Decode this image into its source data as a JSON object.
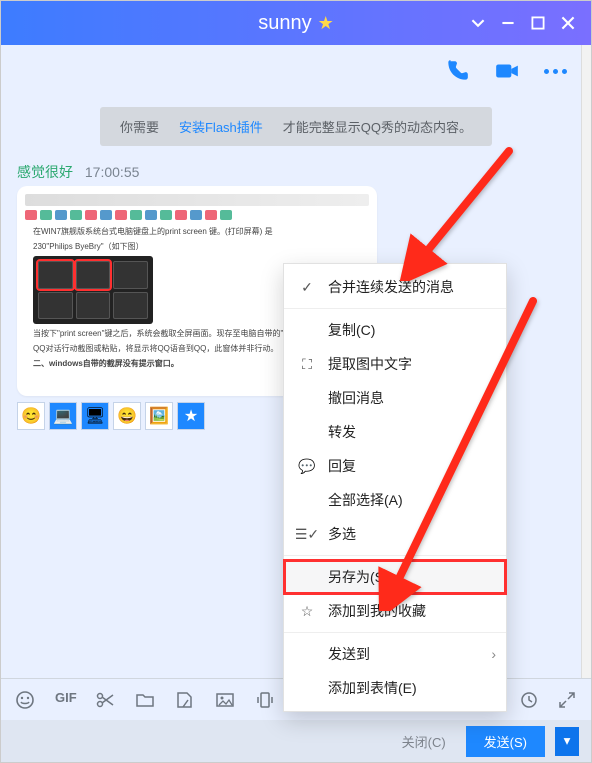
{
  "title": "sunny",
  "notice": {
    "prefix": "你需要",
    "link": "安装Flash插件",
    "suffix": "才能完整显示QQ秀的动态内容。"
  },
  "message": {
    "sender": "感觉很好",
    "time": "17:00:55",
    "inner_lines": {
      "l1": "在WIN7旗舰版系统台式电脑键盘上的print screen 键。(打印屏幕) 是",
      "l2": "230\"Philips ByeBry\"（如下图）",
      "l3": "当按下\"print screen\"键之后，系统会截取全屏画面。现存至电脑自带的\"剪贴板\"中。即使在",
      "l4": "QQ对话行动截图或粘贴，将显示将QQ语音到QQ，此窗体并非行动。",
      "l5": "二、windows自带的截屏没有提示窗口。"
    }
  },
  "footer": {
    "close": "关闭(C)",
    "send": "发送(S)"
  },
  "menu": [
    {
      "key": "merge",
      "icon": "✓",
      "label": "合并连续发送的消息"
    },
    {
      "key": "sep1",
      "sep": true
    },
    {
      "key": "copy",
      "icon": "",
      "label": "复制(C)"
    },
    {
      "key": "ocr",
      "icon": "⛶",
      "label": "提取图中文字"
    },
    {
      "key": "recall",
      "icon": "",
      "label": "撤回消息"
    },
    {
      "key": "forward",
      "icon": "",
      "label": "转发"
    },
    {
      "key": "reply",
      "icon": "💬",
      "label": "回复"
    },
    {
      "key": "selall",
      "icon": "",
      "label": "全部选择(A)"
    },
    {
      "key": "multi",
      "icon": "☰✓",
      "label": "多选"
    },
    {
      "key": "sep2",
      "sep": true
    },
    {
      "key": "saveas",
      "icon": "",
      "label": "另存为(S)...",
      "highlight": true
    },
    {
      "key": "fav",
      "icon": "☆",
      "label": "添加到我的收藏"
    },
    {
      "key": "sep3",
      "sep": true
    },
    {
      "key": "sendto",
      "icon": "",
      "label": "发送到",
      "submenu": true
    },
    {
      "key": "addemo",
      "icon": "",
      "label": "添加到表情(E)"
    }
  ]
}
